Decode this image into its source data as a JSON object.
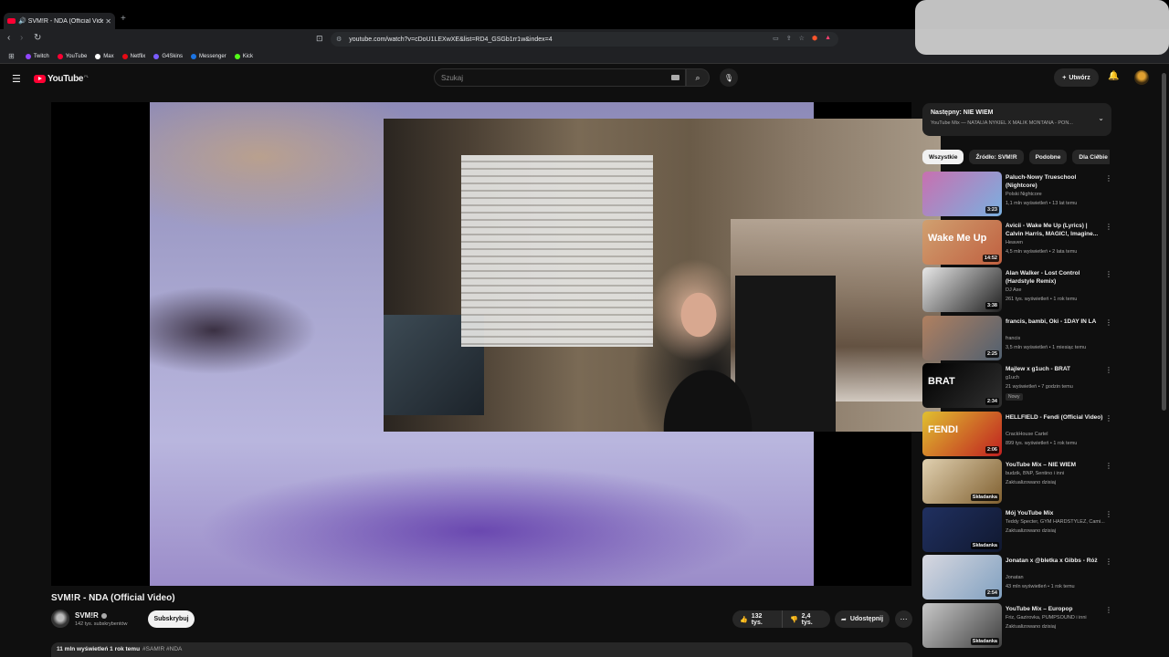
{
  "browser": {
    "tab_title": "SVM!R - NDA (Official Video)",
    "url": "youtube.com/watch?v=cDoU1LEXwXE&list=RD4_GSGb1rr1w&index=4",
    "bookmarks": [
      {
        "label": "Twitch",
        "color": "#9146ff"
      },
      {
        "label": "YouTube",
        "color": "#ff0033"
      },
      {
        "label": "Max",
        "color": "#ffffff"
      },
      {
        "label": "Netflix",
        "color": "#e50914"
      },
      {
        "label": "G4Skins",
        "color": "#7a5cff"
      },
      {
        "label": "Messenger",
        "color": "#1b74e4"
      },
      {
        "label": "Kick",
        "color": "#53fc18"
      }
    ]
  },
  "header": {
    "logo": "YouTube",
    "country_code": "PL",
    "search_placeholder": "Szukaj",
    "create_label": "Utwórz"
  },
  "video": {
    "title": "SVM!R - NDA (Official Video)",
    "channel": "SVM!R",
    "subscribers": "142 tys. subskrybentów",
    "subscribe_label": "Subskrybuj",
    "likes": "132 tys.",
    "dislikes": "2,4 tys.",
    "share_label": "Udostępnij",
    "views_time": "11 mln wyświetleń  1 rok temu",
    "tags": "#SAM!R #NDA"
  },
  "mix": {
    "next_label": "Następny: NIE WIEM",
    "subtitle": "YouTube Mix — NATALIA NYKIEL X MALIK MONTANA - PON..."
  },
  "chips": [
    "Wszystkie",
    "Źródło: SVM!R",
    "Podobne",
    "Dla Ciebie"
  ],
  "recommendations": [
    {
      "title": "Paluch-Nowy Trueschool (Nightcore)",
      "channel": "Polski Nightcore",
      "meta": "1,1 mln wyświetleń • 13 lat temu",
      "duration": "3:23",
      "thumb": "#c870b0",
      "thumb2": "#7ab0e0"
    },
    {
      "title": "Avicii - Wake Me Up (Lyrics) | Calvin Harris, MAGIC!, Imagine...",
      "channel": "Heaven",
      "meta": "4,5 mln wyświetleń • 2 lata temu",
      "duration": "14:52",
      "thumb": "#d0a070",
      "thumb2": "#c06040",
      "thumb_text": "Wake Me Up"
    },
    {
      "title": "Alan Walker - Lost Control (Hardstyle Remix)",
      "channel": "DJ Axe",
      "meta": "261 tys. wyświetleń • 1 rok temu",
      "duration": "3:38",
      "thumb": "#e8e8e8",
      "thumb2": "#202020"
    },
    {
      "title": "francis, bambi, Oki - 1DAY IN LA",
      "channel": "francis",
      "meta": "3,5 mln wyświetleń • 1 miesiąc temu",
      "duration": "2:25",
      "thumb": "#b08060",
      "thumb2": "#506070"
    },
    {
      "title": "Majlew x g1uch - BRAT",
      "channel": "g1uch",
      "meta": "21 wyświetleń • 7 godzin temu",
      "badge": "Nowy",
      "duration": "2:34",
      "thumb": "#000000",
      "thumb2": "#303030",
      "thumb_text": "BRAT"
    },
    {
      "title": "HELLFIELD - Fendi (Official Video)",
      "channel": "CrackHouse Cartel",
      "meta": "899 tys. wyświetleń • 1 rok temu",
      "duration": "2:06",
      "thumb": "#e0c030",
      "thumb2": "#c02020",
      "thumb_text": "FENDI"
    },
    {
      "title": "YouTube Mix – NIE WIEM",
      "channel": "budzik, BNP, Sentino i inni",
      "meta": "Zaktualizowano dzisiaj",
      "duration": "Składanka",
      "thumb": "#e0d0b0",
      "thumb2": "#806030"
    },
    {
      "title": "Mój YouTube Mix",
      "channel": "Teddy Specter, GYM HARDSTYLEZ, Cami...",
      "meta": "Zaktualizowano dzisiaj",
      "duration": "Składanka",
      "thumb": "#203060",
      "thumb2": "#101830"
    },
    {
      "title": "Jonatan x @bletka x Gibbs - Róż",
      "channel": "Jonatan",
      "meta": "43 mln wyświetleń • 1 rok temu",
      "duration": "2:54",
      "thumb": "#d8d8e0",
      "thumb2": "#80a0c0"
    },
    {
      "title": "YouTube Mix – Europop",
      "channel": "Friz, Gazirovka, PUMPSOUND i inni",
      "meta": "Zaktualizowano dzisiaj",
      "duration": "Składanka",
      "thumb": "#c8c8c8",
      "thumb2": "#404040"
    }
  ]
}
